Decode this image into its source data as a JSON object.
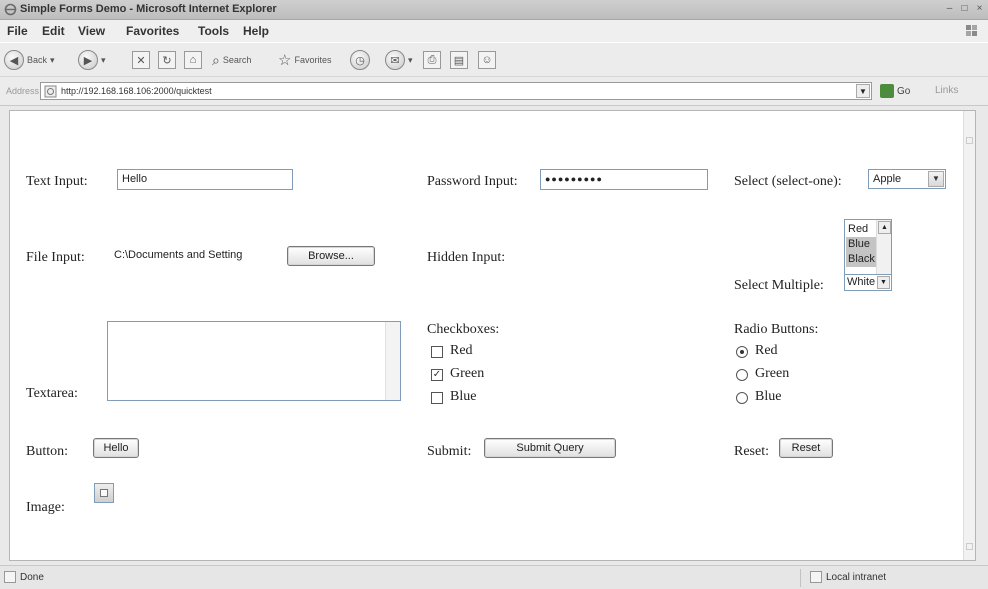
{
  "window": {
    "title": "Simple Forms Demo - Microsoft Internet Explorer"
  },
  "menu": [
    "File",
    "Edit",
    "View",
    "Favorites",
    "Tools",
    "Help"
  ],
  "toolbar": {
    "back_label": "Back",
    "search_label": "Search",
    "favorites_label": "Favorites"
  },
  "address": {
    "label": "Address",
    "url": "http://192.168.168.106:2000/quicktest",
    "go_label": "Go",
    "links_label": "Links"
  },
  "form": {
    "text_input": {
      "label": "Text Input:",
      "value": "Hello"
    },
    "password_input": {
      "label": "Password Input:",
      "masked_value": "●●●●●●●●●"
    },
    "select_one": {
      "label": "Select (select-one):",
      "value": "Apple"
    },
    "file_input": {
      "label": "File Input:",
      "value": "C:\\Documents and Setting",
      "browse_label": "Browse..."
    },
    "hidden_input": {
      "label": "Hidden Input:"
    },
    "select_multiple": {
      "label": "Select Multiple:",
      "options": [
        "Red",
        "Blue",
        "Black",
        "White"
      ],
      "selected": [
        "Blue",
        "Black"
      ]
    },
    "textarea": {
      "label": "Textarea:",
      "value": ""
    },
    "checkboxes": {
      "label": "Checkboxes:",
      "items": [
        {
          "label": "Red",
          "checked": false
        },
        {
          "label": "Green",
          "checked": true
        },
        {
          "label": "Blue",
          "checked": false
        }
      ]
    },
    "radio_buttons": {
      "label": "Radio Buttons:",
      "items": [
        {
          "label": "Red",
          "checked": true
        },
        {
          "label": "Green",
          "checked": false
        },
        {
          "label": "Blue",
          "checked": false
        }
      ]
    },
    "button": {
      "label": "Button:",
      "value": "Hello"
    },
    "submit": {
      "label": "Submit:",
      "value": "Submit Query"
    },
    "reset": {
      "label": "Reset:",
      "value": "Reset"
    },
    "image": {
      "label": "Image:"
    }
  },
  "status": {
    "text": "Done",
    "zone": "Local intranet"
  }
}
